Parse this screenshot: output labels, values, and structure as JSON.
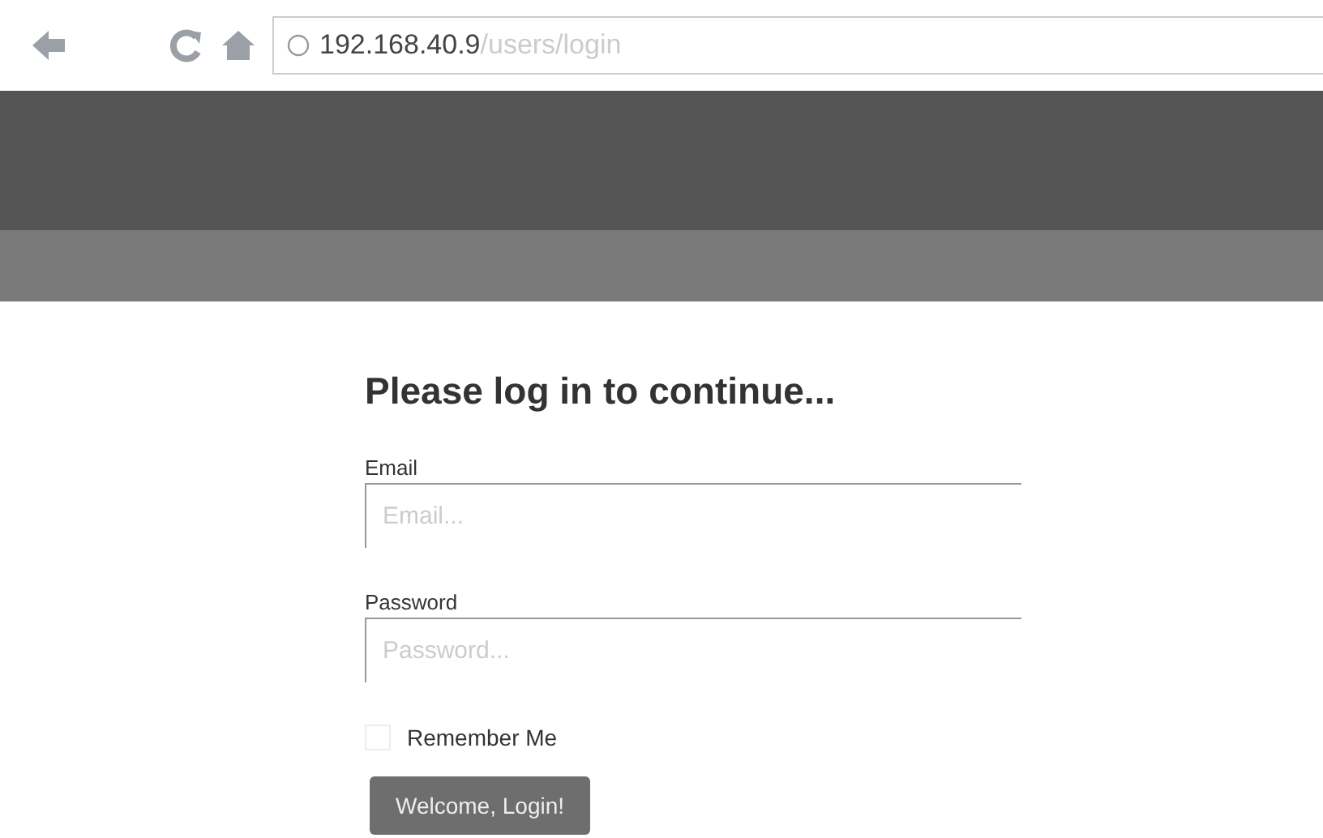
{
  "browser": {
    "url_host": "192.168.40.9",
    "url_path": "/users/login"
  },
  "form": {
    "title": "Please log in to continue...",
    "fields": [
      {
        "label": "Email",
        "placeholder": "Email..."
      },
      {
        "label": "Password",
        "placeholder": "Password..."
      }
    ],
    "remember": {
      "label": "Remember Me",
      "checked": false
    },
    "submit": "Welcome, Login!"
  }
}
